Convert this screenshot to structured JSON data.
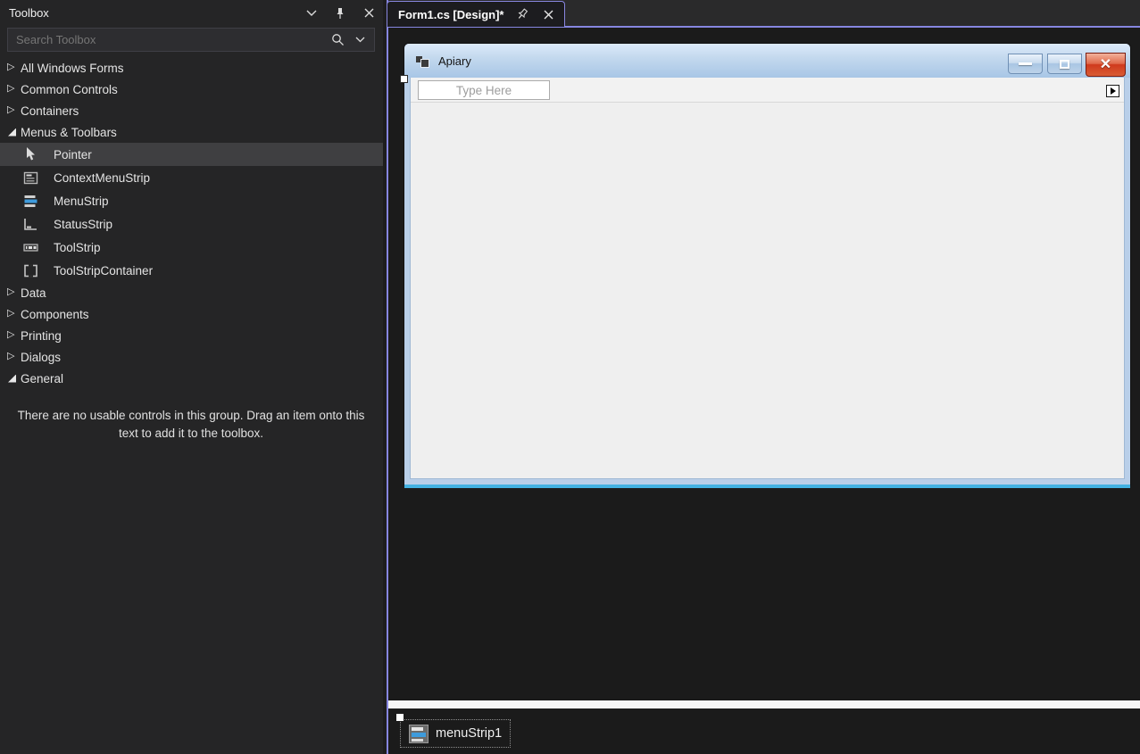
{
  "colors": {
    "accent_purple": "#8686e0",
    "toolbox_bg": "#252526",
    "doc_bg": "#1b1b1b",
    "selection_bg": "#3f3f41",
    "form_titlebar_blue": "#b9cfe9",
    "form_client_gray": "#f0f0f0",
    "close_button_red": "#cf3a1d",
    "cyan_edge": "#43b2e2"
  },
  "toolbox": {
    "title": "Toolbox",
    "search_placeholder": "Search Toolbox",
    "rows": [
      {
        "label": "All Windows Forms",
        "kind": "category",
        "state": "collapsed"
      },
      {
        "label": "Common Controls",
        "kind": "category",
        "state": "collapsed"
      },
      {
        "label": "Containers",
        "kind": "category",
        "state": "collapsed"
      },
      {
        "label": "Menus & Toolbars",
        "kind": "category",
        "state": "expanded"
      },
      {
        "label": "Pointer",
        "kind": "item",
        "icon": "pointer-icon",
        "selected": true
      },
      {
        "label": "ContextMenuStrip",
        "kind": "item",
        "icon": "contextmenustrip-icon"
      },
      {
        "label": "MenuStrip",
        "kind": "item",
        "icon": "menustrip-icon"
      },
      {
        "label": "StatusStrip",
        "kind": "item",
        "icon": "statusstrip-icon"
      },
      {
        "label": "ToolStrip",
        "kind": "item",
        "icon": "toolstrip-icon"
      },
      {
        "label": "ToolStripContainer",
        "kind": "item",
        "icon": "toolstripcontainer-icon"
      },
      {
        "label": "Data",
        "kind": "category",
        "state": "collapsed"
      },
      {
        "label": "Components",
        "kind": "category",
        "state": "collapsed"
      },
      {
        "label": "Printing",
        "kind": "category",
        "state": "collapsed"
      },
      {
        "label": "Dialogs",
        "kind": "category",
        "state": "collapsed"
      },
      {
        "label": "General",
        "kind": "category",
        "state": "expanded"
      }
    ],
    "empty_group_message": "There are no usable controls in this group. Drag an item onto this text to add it to the toolbox."
  },
  "editor": {
    "tab_label": "Form1.cs [Design]*",
    "form": {
      "title": "Apiary",
      "menu_placeholder": "Type Here"
    },
    "tray": {
      "component_label": "menuStrip1"
    }
  }
}
